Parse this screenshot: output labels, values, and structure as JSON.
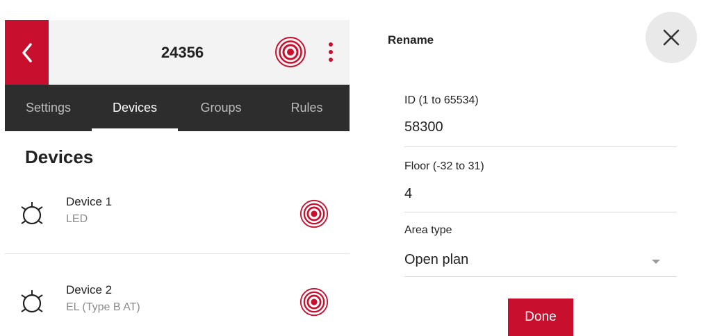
{
  "app": {
    "title": "24356",
    "tabs": [
      {
        "label": "Settings",
        "active": false
      },
      {
        "label": "Devices",
        "active": true
      },
      {
        "label": "Groups",
        "active": false
      },
      {
        "label": "Rules",
        "active": false
      }
    ],
    "section_title": "Devices",
    "devices": [
      {
        "name": "Device 1",
        "type": "LED"
      },
      {
        "name": "Device 2",
        "type": "EL (Type B AT)"
      }
    ]
  },
  "dialog": {
    "title": "Rename",
    "fields": {
      "id": {
        "label": "ID (1 to 65534)",
        "value": "58300"
      },
      "floor": {
        "label": "Floor (-32 to 31)",
        "value": "4"
      },
      "area_type": {
        "label": "Area type",
        "value": "Open plan"
      }
    },
    "done_label": "Done"
  },
  "colors": {
    "accent": "#c8102e",
    "tab_bar": "#2d2d2d",
    "header_bg": "#f3f3f3",
    "close_bg": "#e9e9e9"
  },
  "icons": {
    "back": "chevron-left-icon",
    "identify": "identify-target-icon",
    "menu": "more-vertical-icon",
    "device": "light-bulb-icon",
    "close": "close-icon",
    "dropdown": "caret-down-icon"
  }
}
